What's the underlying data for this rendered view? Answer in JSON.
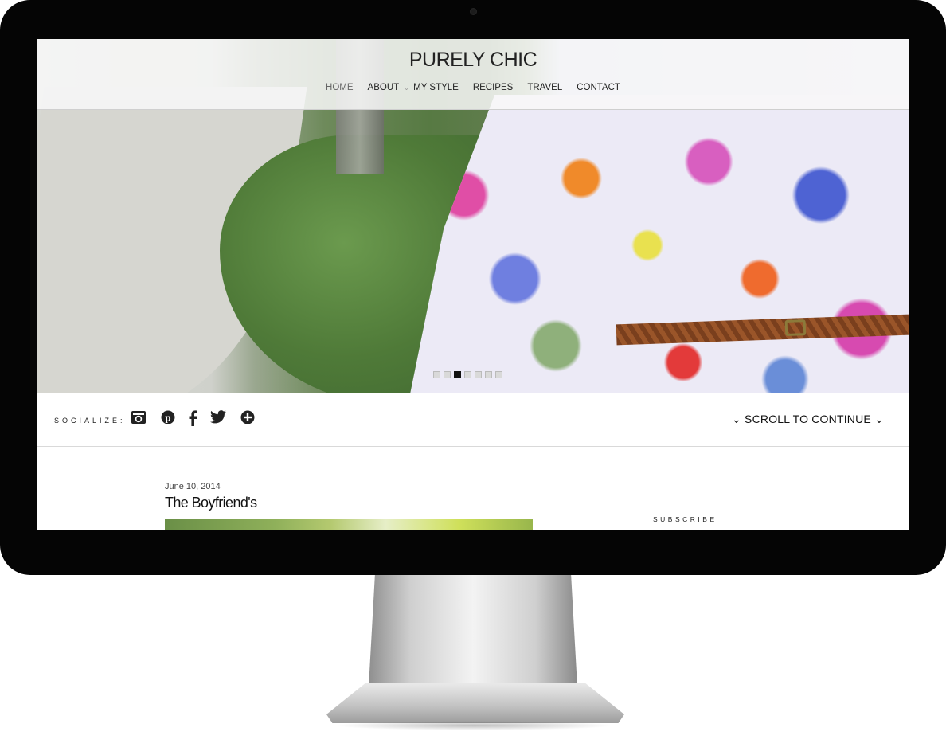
{
  "site": {
    "title": "PURELY CHIC"
  },
  "nav": {
    "items": [
      {
        "label": "HOME",
        "active": true
      },
      {
        "label": "ABOUT"
      },
      {
        "label": "MY STYLE"
      },
      {
        "label": "RECIPES"
      },
      {
        "label": "TRAVEL"
      },
      {
        "label": "CONTACT"
      }
    ]
  },
  "slider": {
    "dot_count": 7,
    "active_index": 2
  },
  "social": {
    "label": "SOCIALIZE:",
    "icons": [
      "instagram-icon",
      "pinterest-icon",
      "facebook-icon",
      "twitter-icon",
      "plus-icon"
    ],
    "scroll_label": "SCROLL TO CONTINUE"
  },
  "post": {
    "date": "June 10, 2014",
    "title": "The Boyfriend's"
  },
  "sidebar": {
    "subscribe_label": "SUBSCRIBE"
  },
  "colors": {
    "bezel": "#050505",
    "text": "#222222",
    "header_overlay": "#f8f8f8"
  }
}
